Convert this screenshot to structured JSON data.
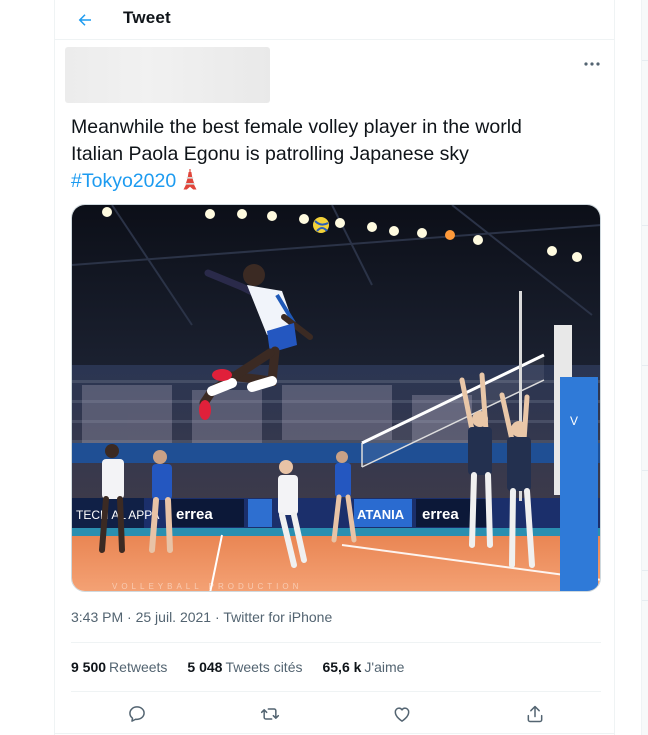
{
  "header": {
    "title": "Tweet",
    "back_icon": "arrow-left-icon"
  },
  "tweet": {
    "text_line1": "Meanwhile the best female volley player in the world",
    "text_line2": "Italian Paola Egonu is patrolling Japanese sky",
    "hashtag": "#Tokyo2020",
    "emoji": "tokyo-tower-emoji",
    "more_icon": "more-horizontal-icon",
    "media_description_icon": "volleyball-photo",
    "media_banners": {
      "left": "TECH   AL APPA",
      "errea1": "errea",
      "atania": "ATANIA",
      "errea2": "errea",
      "watermark": "VOLLEYBALL PRODUCTION"
    }
  },
  "meta": {
    "time": "3:43 PM",
    "date": "25 juil. 2021",
    "source": "Twitter for iPhone",
    "sep": "·"
  },
  "stats": {
    "retweets": {
      "count": "9 500",
      "label": "Retweets"
    },
    "quotes": {
      "count": "5 048",
      "label": "Tweets cités"
    },
    "likes": {
      "count": "65,6 k",
      "label": "J'aime"
    }
  },
  "actions": [
    "reply-icon",
    "retweet-icon",
    "like-icon",
    "share-icon"
  ],
  "colors": {
    "accent": "#1d9bf0",
    "text": "#0f1419",
    "secondary": "#536471",
    "court_orange": "#f0925e",
    "court_blue": "#1f5fa8"
  }
}
